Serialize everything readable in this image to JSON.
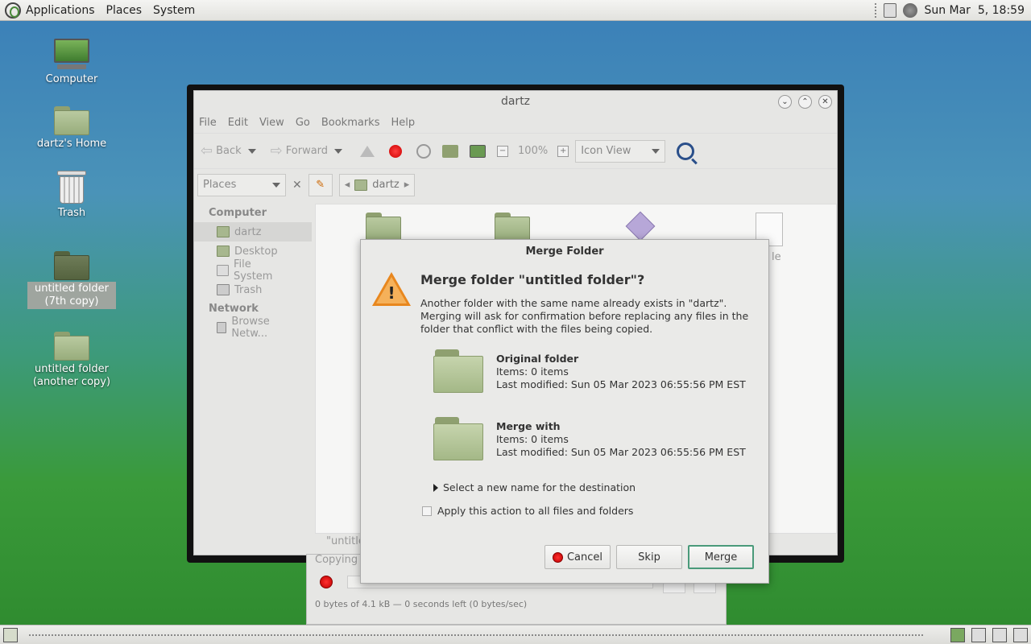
{
  "top_panel": {
    "menus": [
      "Applications",
      "Places",
      "System"
    ],
    "clock": "Sun Mar  5, 18:59"
  },
  "desktop": {
    "icons": [
      {
        "label": "Computer",
        "icon": "computer-icon"
      },
      {
        "label": "dartz's Home",
        "icon": "home-folder-icon"
      },
      {
        "label": "Trash",
        "icon": "trash-icon"
      },
      {
        "label": "untitled folder (7th copy)",
        "icon": "folder-icon",
        "selected": true
      },
      {
        "label": "untitled folder (another copy)",
        "icon": "folder-icon"
      }
    ]
  },
  "file_manager": {
    "title": "dartz",
    "menus": [
      "File",
      "Edit",
      "View",
      "Go",
      "Bookmarks",
      "Help"
    ],
    "toolbar": {
      "back": "Back",
      "forward": "Forward",
      "zoom": "100%",
      "view_mode": "Icon View"
    },
    "location": {
      "places_label": "Places",
      "crumb": "dartz"
    },
    "sidebar": {
      "computer_head": "Computer",
      "items": [
        "dartz",
        "Desktop",
        "File System",
        "Trash"
      ],
      "network_head": "Network",
      "network_items": [
        "Browse Netw..."
      ]
    },
    "status_fragment": "\"untitled",
    "partial_file_label": "le"
  },
  "copy_window": {
    "title_fragment": "Copying \"",
    "progress_text": "0 bytes of 4.1 kB — 0 seconds left (0 bytes/sec)",
    "progress": 0
  },
  "dialog": {
    "title": "Merge Folder",
    "heading": "Merge folder \"untitled folder\"?",
    "line1": "Another folder with the same name already exists in \"dartz\".",
    "line2": "Merging will ask for confirmation before replacing any files in the folder that conflict with the files being copied.",
    "original": {
      "name": "Original folder",
      "items": "Items: 0 items",
      "modified": "Last modified: Sun 05 Mar 2023 06:55:56 PM EST"
    },
    "merge_with": {
      "name": "Merge with",
      "items": "Items: 0 items",
      "modified": "Last modified: Sun 05 Mar 2023 06:55:56 PM EST"
    },
    "expander_label": "Select a new name for the destination",
    "apply_all_label": "Apply this action to all files and folders",
    "apply_all_checked": false,
    "buttons": {
      "cancel": "Cancel",
      "skip": "Skip",
      "merge": "Merge"
    }
  }
}
